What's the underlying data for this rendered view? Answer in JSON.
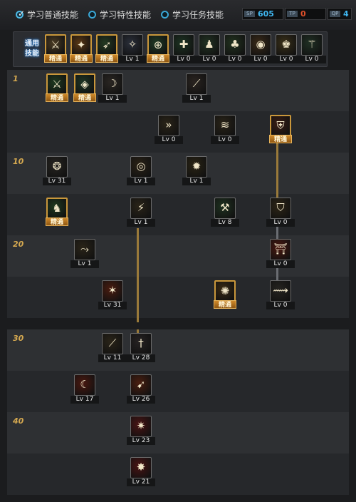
{
  "tabs": [
    {
      "label": "学习普通技能",
      "checked": true
    },
    {
      "label": "学习特性技能",
      "checked": false
    },
    {
      "label": "学习任务技能",
      "checked": false
    }
  ],
  "counters": [
    {
      "icon": "SP",
      "value": "605",
      "color": "#3fb6f0"
    },
    {
      "icon": "TP",
      "value": "0",
      "color": "#e0502a"
    },
    {
      "icon": "QP",
      "value": "4",
      "color": "#3fb6f0"
    }
  ],
  "common_label": "通用\n技能",
  "common_skills": [
    {
      "icon": "summon-icon",
      "glyph": "⚔",
      "bg": "#4a3a22",
      "badge": "精通"
    },
    {
      "icon": "flame-wing-icon",
      "glyph": "✦",
      "bg": "#5a3814",
      "badge": "精通"
    },
    {
      "icon": "dash-runner-icon",
      "glyph": "➶",
      "bg": "#233a22",
      "badge": "精通"
    },
    {
      "icon": "wing-emblem-icon",
      "glyph": "✧",
      "bg": "#2a2f3a",
      "level": "Lv 1"
    },
    {
      "icon": "target-cross-icon",
      "glyph": "⊕",
      "bg": "#1f3a24",
      "badge": "精通"
    },
    {
      "icon": "green-reticle-icon",
      "glyph": "✚",
      "bg": "#1c3322",
      "level": "Lv 0"
    },
    {
      "icon": "figure-green-icon",
      "glyph": "♟",
      "bg": "#213322",
      "level": "Lv 0"
    },
    {
      "icon": "mushroom-icon",
      "glyph": "♣",
      "bg": "#22331f",
      "level": "Lv 0"
    },
    {
      "icon": "eye-orb-icon",
      "glyph": "◉",
      "bg": "#3a2a18",
      "level": "Lv 0"
    },
    {
      "icon": "golden-figure-icon",
      "glyph": "♚",
      "bg": "#3a3018",
      "level": "Lv 0"
    },
    {
      "icon": "green-staff-icon",
      "glyph": "⚚",
      "bg": "#203024",
      "level": "Lv 0"
    }
  ],
  "level_markers": [
    "1",
    "10",
    "20",
    "30",
    "40"
  ],
  "skills": [
    {
      "icon": "green-slash-icon",
      "glyph": "⚔",
      "bg": "#1f3a20",
      "badge": "精通",
      "row": 0,
      "col": 0
    },
    {
      "icon": "green-eye-icon",
      "glyph": "◈",
      "bg": "#1e3524",
      "badge": "精通",
      "row": 0,
      "col": 1
    },
    {
      "icon": "crescent-slash-icon",
      "glyph": "☽",
      "bg": "#2a2622",
      "level": "Lv 1",
      "row": 0,
      "col": 2
    },
    {
      "icon": "swoop-slash-icon",
      "glyph": "⟋",
      "bg": "#2a2420",
      "level": "Lv 1",
      "row": 0,
      "col": 5
    },
    {
      "icon": "triple-arrow-icon",
      "glyph": "»",
      "bg": "#2a2418",
      "level": "Lv 0",
      "row": 1,
      "col": 4
    },
    {
      "icon": "wave-burst-icon",
      "glyph": "≋",
      "bg": "#2a2418",
      "level": "Lv 0",
      "row": 1,
      "col": 6
    },
    {
      "icon": "shield-cross-icon",
      "glyph": "⛨",
      "bg": "#3a1d14",
      "badge": "精通",
      "row": 1,
      "col": 8
    },
    {
      "icon": "whirl-slash-icon",
      "glyph": "❂",
      "bg": "#262420",
      "level": "Lv 31",
      "row": 2,
      "col": 0
    },
    {
      "icon": "spiral-icon",
      "glyph": "◎",
      "bg": "#2a2216",
      "level": "Lv 1",
      "row": 2,
      "col": 3
    },
    {
      "icon": "explosion-icon",
      "glyph": "✹",
      "bg": "#2a2414",
      "level": "Lv 1",
      "row": 2,
      "col": 5
    },
    {
      "icon": "green-dragon-icon",
      "glyph": "♞",
      "bg": "#1f3a20",
      "badge": "精通",
      "row": 3,
      "col": 0
    },
    {
      "icon": "sword-spark-icon",
      "glyph": "⚡",
      "bg": "#2a2418",
      "level": "Lv 1",
      "row": 3,
      "col": 3
    },
    {
      "icon": "green-blade-icon",
      "glyph": "⚒",
      "bg": "#1e3220",
      "level": "Lv 8",
      "row": 3,
      "col": 6
    },
    {
      "icon": "shield-burst-icon",
      "glyph": "⛉",
      "bg": "#2e2616",
      "level": "Lv 0",
      "row": 3,
      "col": 8
    },
    {
      "icon": "arc-dash-icon",
      "glyph": "⤳",
      "bg": "#2a2418",
      "level": "Lv 1",
      "row": 4,
      "col": 1
    },
    {
      "icon": "red-gate-icon",
      "glyph": "⛩",
      "bg": "#4a1810",
      "level": "Lv 0",
      "row": 4,
      "col": 8
    },
    {
      "icon": "fire-slash-icon",
      "glyph": "✶",
      "bg": "#4a1c10",
      "level": "Lv 31",
      "row": 5,
      "col": 2
    },
    {
      "icon": "golden-burst-icon",
      "glyph": "✺",
      "bg": "#3a2a12",
      "badge": "精通",
      "row": 5,
      "col": 6
    },
    {
      "icon": "wind-slash-icon",
      "glyph": "⟿",
      "bg": "#262420",
      "level": "Lv 0",
      "row": 5,
      "col": 8
    },
    {
      "icon": "flame-streak-icon",
      "glyph": "⟋",
      "bg": "#2a2418",
      "level": "Lv 11",
      "row": 6,
      "col": 2
    },
    {
      "icon": "sword-hilt-icon",
      "glyph": "†",
      "bg": "#262222",
      "level": "Lv 28",
      "row": 6,
      "col": 3
    },
    {
      "icon": "red-moon-icon",
      "glyph": "☾",
      "bg": "#4a1810",
      "level": "Lv 17",
      "row": 7,
      "col": 1
    },
    {
      "icon": "phoenix-icon",
      "glyph": "➹",
      "bg": "#4a1e10",
      "level": "Lv 26",
      "row": 7,
      "col": 3
    },
    {
      "icon": "red-star-icon",
      "glyph": "✷",
      "bg": "#4a1414",
      "level": "Lv 23",
      "row": 8,
      "col": 3
    },
    {
      "icon": "red-flare-icon",
      "glyph": "✸",
      "bg": "#4a1414",
      "level": "Lv 21",
      "row": 9,
      "col": 3
    }
  ]
}
